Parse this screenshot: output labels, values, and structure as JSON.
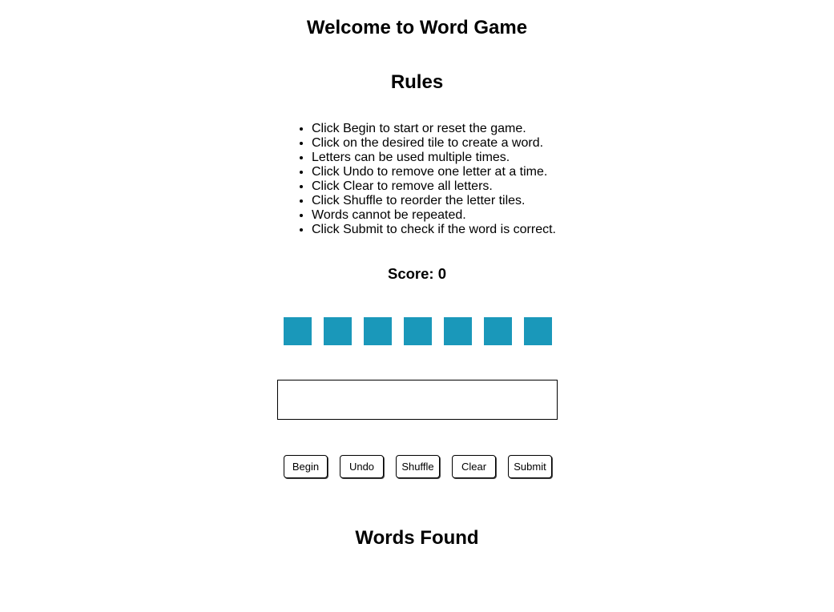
{
  "title": "Welcome to Word Game",
  "rules": {
    "heading": "Rules",
    "items": [
      "Click Begin to start or reset the game.",
      "Click on the desired tile to create a word.",
      "Letters can be used multiple times.",
      "Click Undo to remove one letter at a time.",
      "Click Clear to remove all letters.",
      "Click Shuffle to reorder the letter tiles.",
      "Words cannot be repeated.",
      "Click Submit to check if the word is correct."
    ]
  },
  "score": {
    "text": "Score: 0"
  },
  "tiles": {
    "color": "#1a98ba",
    "letters": [
      "",
      "",
      "",
      "",
      "",
      "",
      ""
    ]
  },
  "word_input": {
    "value": ""
  },
  "buttons": {
    "begin": "Begin",
    "undo": "Undo",
    "shuffle": "Shuffle",
    "clear": "Clear",
    "submit": "Submit"
  },
  "words_found": {
    "heading": "Words Found",
    "items": []
  }
}
